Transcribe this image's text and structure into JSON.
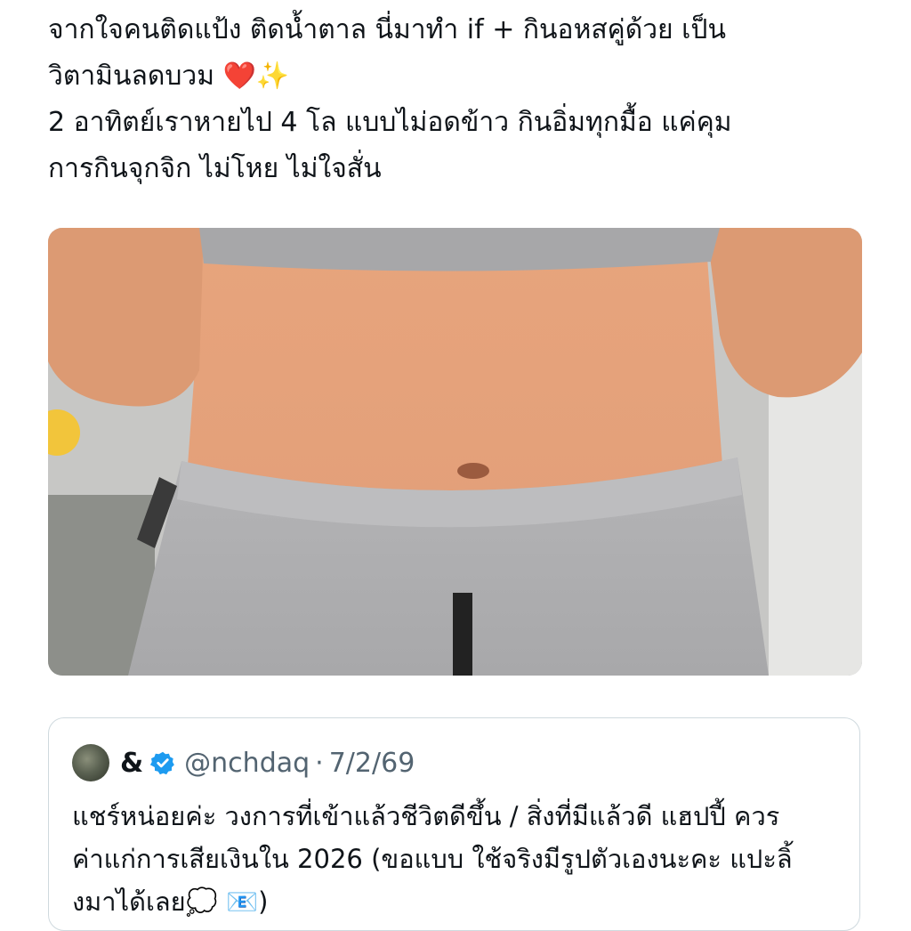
{
  "post": {
    "lines": [
      "จากใจคนติดแป้ง ติดน้ำตาล นี่มาทำ if + กินอหสคู่ด้วย เป็น",
      "วิตามินลดบวม",
      "2 อาทิตย์เราหายไป 4 โล แบบไม่อดข้าว กินอิ่มทุกมื้อ แค่คุม",
      "การกินจุกจิก ไม่โหย ไม่ใจสั่น"
    ],
    "emojis": {
      "heart": "❤️",
      "sparkles": "✨"
    }
  },
  "quote": {
    "display_name": "&",
    "handle": "@nchdaq",
    "separator": "·",
    "date": "7/2/69",
    "lines": [
      "แชร์หน่อยค่ะ วงการที่เข้าแล้วชีวิตดีขึ้น / สิ่งที่มีแล้วดี แฮปปี้ ควร",
      "ค่าแก่การเสียเงินใน 2026 (ขอแบบ ใช้จริงมีรูปตัวเองนะคะ แปะลิ้",
      "งมาได้เลย"
    ],
    "emojis": {
      "thought": "💭",
      "envelope": "📧"
    },
    "closing": ")"
  },
  "colors": {
    "verified": "#1d9bf0",
    "muted": "#536471",
    "border": "#cfd9de"
  }
}
